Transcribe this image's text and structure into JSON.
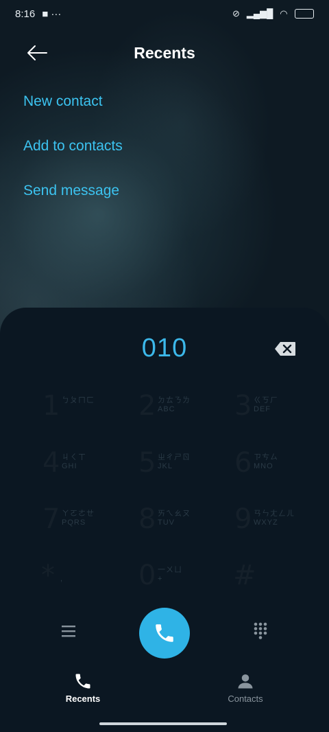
{
  "status_bar": {
    "time": "8:16",
    "right_text": "",
    "battery": ""
  },
  "header": {
    "title": "Recents"
  },
  "actions": {
    "new_contact": "New contact",
    "add_to_contacts": "Add to contacts",
    "send_message": "Send message"
  },
  "dialer": {
    "number": "010",
    "keys": [
      {
        "digit": "1",
        "sub1": "ㄅㄆㄇㄈ",
        "sub2": ""
      },
      {
        "digit": "2",
        "sub1": "ㄉㄊㄋㄌ",
        "sub2": "ABC"
      },
      {
        "digit": "3",
        "sub1": "ㄍㄎㄏ",
        "sub2": "DEF"
      },
      {
        "digit": "4",
        "sub1": "ㄐㄑㄒ",
        "sub2": "GHI"
      },
      {
        "digit": "5",
        "sub1": "ㄓㄔㄕㄖ",
        "sub2": "JKL"
      },
      {
        "digit": "6",
        "sub1": "ㄗㄘㄙ",
        "sub2": "MNO"
      },
      {
        "digit": "7",
        "sub1": "ㄚㄛㄜㄝ",
        "sub2": "PQRS"
      },
      {
        "digit": "8",
        "sub1": "ㄞㄟㄠㄡ",
        "sub2": "TUV"
      },
      {
        "digit": "9",
        "sub1": "ㄢㄣㄤㄥㄦ",
        "sub2": "WXYZ"
      },
      {
        "digit": "*",
        "sub1": "",
        "sub2": ","
      },
      {
        "digit": "0",
        "sub1": "一ㄨㄩ",
        "sub2": "+"
      },
      {
        "digit": "#",
        "sub1": "",
        "sub2": ""
      }
    ]
  },
  "nav": {
    "recents": "Recents",
    "contacts": "Contacts"
  },
  "colors": {
    "accent": "#3cc3f0",
    "call_button": "#2fb3e6",
    "background": "#0b1620"
  }
}
